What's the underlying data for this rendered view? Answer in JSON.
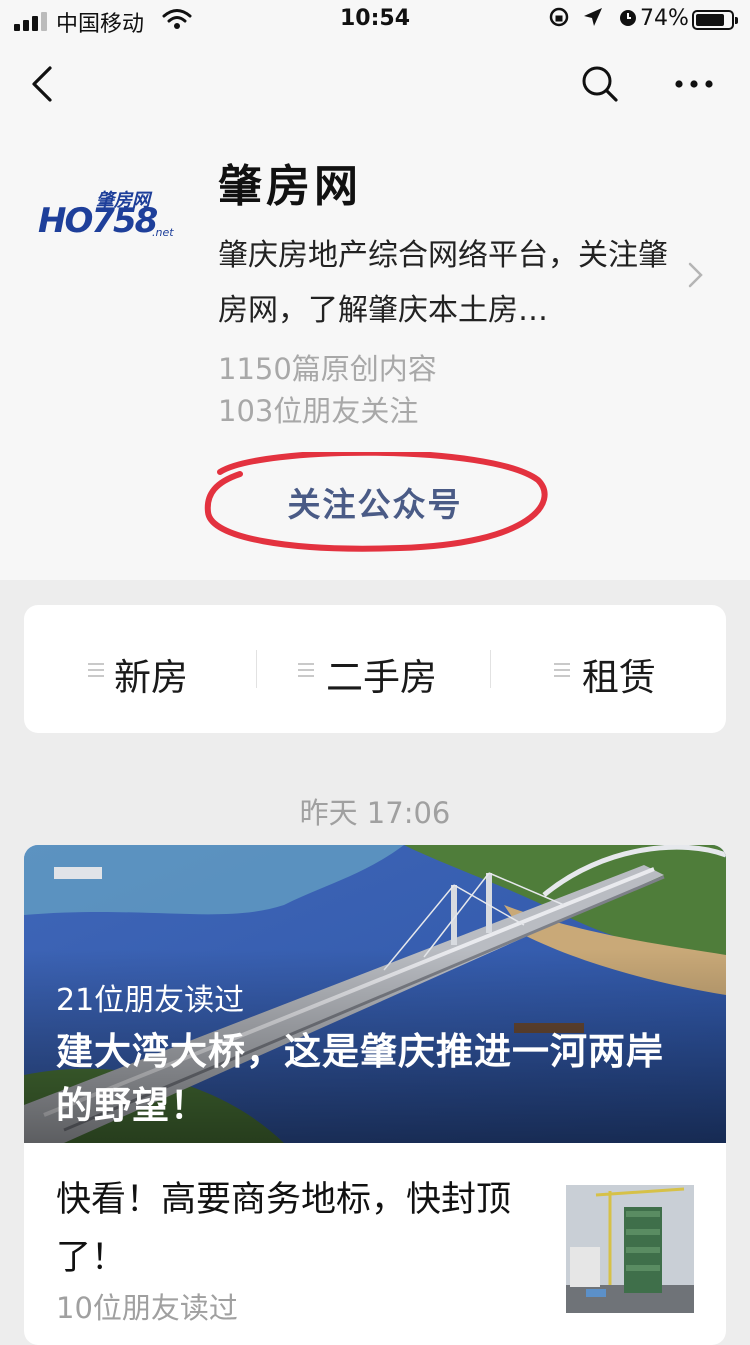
{
  "status_bar": {
    "carrier": "中国移动",
    "time": "10:54",
    "battery": "74%"
  },
  "nav": {
    "back_icon": "chevron-left-icon",
    "search_icon": "search-icon",
    "more_icon": "more-icon"
  },
  "profile": {
    "name": "肇房网",
    "description": "肇庆房地产综合网络平台，关注肇房网，了解肇庆本土房…",
    "original_count": "1150篇原创内容",
    "friends_following": "103位朋友关注",
    "follow_label": "关注公众号",
    "logo": {
      "main": "HO758",
      "sub": "肇房网",
      "suffix": ".net"
    }
  },
  "menu": {
    "items": [
      {
        "label": "新房"
      },
      {
        "label": "二手房"
      },
      {
        "label": "租赁"
      }
    ]
  },
  "feed": {
    "date": "昨天 17:06",
    "articles": [
      {
        "read_count": "21位朋友读过",
        "title": "建大湾大桥，这是肇庆推进一河两岸的野望！"
      },
      {
        "title": "快看！高要商务地标，快封顶了！",
        "read_count": "10位朋友读过"
      }
    ]
  },
  "colors": {
    "accent": "#4a5b86",
    "annotation_circle": "#e3323f"
  }
}
